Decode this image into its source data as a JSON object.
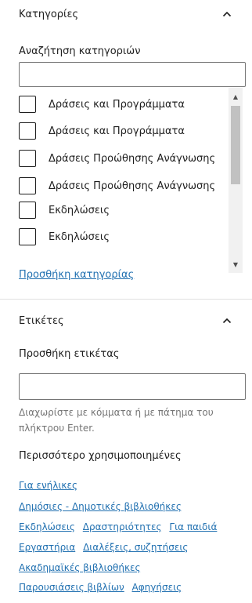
{
  "categories": {
    "title": "Κατηγορίες",
    "search_label": "Αναζήτηση κατηγοριών",
    "search_value": "",
    "items": [
      {
        "label": "Δράσεις και Προγράμματα",
        "checked": false
      },
      {
        "label": "Δράσεις και Προγράμματα",
        "checked": false
      },
      {
        "label": "Δράσεις Προώθησης Ανάγνωσης",
        "checked": false
      },
      {
        "label": "Δράσεις Προώθησης Ανάγνωσης",
        "checked": false
      },
      {
        "label": "Εκδηλώσεις",
        "checked": false
      },
      {
        "label": "Εκδηλώσεις",
        "checked": false
      }
    ],
    "add_link": "Προσθήκη κατηγορίας"
  },
  "tags": {
    "title": "Ετικέτες",
    "add_label": "Προσθήκη ετικέτας",
    "add_value": "",
    "help_text": "Διαχωρίστε με κόμματα ή με πάτημα του πλήκτρου Enter.",
    "most_used_title": "Περισσότερο χρησιμοποιημένες",
    "most_used_lines": [
      [
        "Για ενήλικες"
      ],
      [
        "Δημόσιες - Δημοτικές βιβλιοθήκες"
      ],
      [
        "Εκδηλώσεις",
        "Δραστηριότητες",
        "Για παιδιά"
      ],
      [
        "Εργαστήρια",
        "Διαλέξεις, συζητήσεις"
      ],
      [
        "Ακαδημαϊκές βιβλιοθήκες"
      ],
      [
        "Παρουσιάσεις βιβλίων",
        "Αφηγήσεις"
      ]
    ]
  },
  "colors": {
    "link": "#2271b1",
    "border": "#757575",
    "text": "#1e1e1e"
  }
}
